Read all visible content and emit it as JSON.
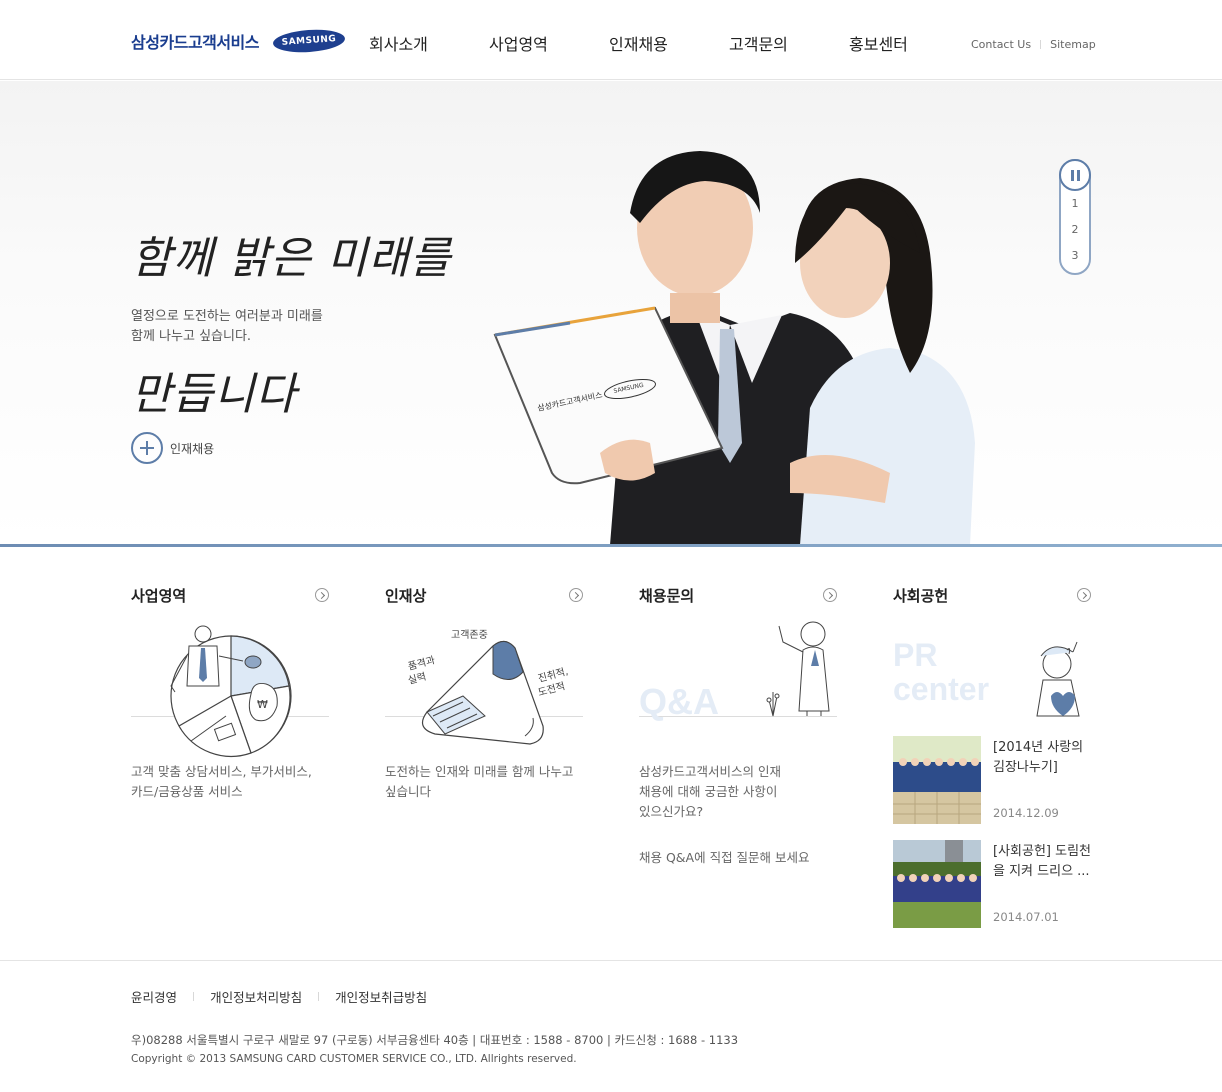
{
  "header": {
    "logo_text": "삼성카드고객서비스",
    "logo_badge": "SAMSUNG",
    "nav": [
      "회사소개",
      "사업영역",
      "인재채용",
      "고객문의",
      "홍보센터"
    ],
    "util": {
      "contact": "Contact Us",
      "sitemap": "Sitemap"
    }
  },
  "hero": {
    "title_line1": "함께 밝은 미래를",
    "title_line2": "만듭니다",
    "desc_line1": "열정으로 도전하는 여러분과 미래를",
    "desc_line2": "함께 나누고 싶습니다.",
    "link_label": "인재채용",
    "laptop_text": "삼성카드고객서비스",
    "laptop_badge": "SAMSUNG",
    "pager": {
      "pages": [
        "1",
        "2",
        "3"
      ]
    }
  },
  "sections": {
    "business": {
      "title": "사업영역",
      "text": "고객 맞춤 상담서비스, 부가서비스,\n카드/금융상품 서비스"
    },
    "talent": {
      "title": "인재상",
      "ill_label1": "고객존중",
      "ill_label2a": "품격과",
      "ill_label2b": "실력",
      "ill_label3a": "진취적,",
      "ill_label3b": "도전적",
      "text": "도전하는 인재와 미래를 함께 나누고\n싶습니다"
    },
    "recruit": {
      "title": "채용문의",
      "ill_label": "Q&A",
      "text": "삼성카드고객서비스의 인재\n채용에 대해 궁금한 사항이\n있으신가요?",
      "text2": "채용 Q&A에 직접 질문해 보세요"
    },
    "social": {
      "title": "사회공헌",
      "ill_label1": "PR",
      "ill_label2": "center",
      "items": [
        {
          "title": "[2014년 사랑의 김장나누기]",
          "date": "2014.12.09"
        },
        {
          "title": "[사회공헌] 도림천을 지켜 드리으 ...",
          "date": "2014.07.01"
        }
      ]
    }
  },
  "footer": {
    "links": [
      "윤리경영",
      "개인정보처리방침",
      "개인정보취급방침"
    ],
    "address": "우)08288 서울특별시 구로구 새말로 97 (구로동) 서부금융센타 40층   |   대표번호 : 1588 - 8700   |   카드신청 : 1688 - 1133",
    "copyright": "Copyright © 2013 SAMSUNG CARD CUSTOMER SERVICE CO., LTD. Allrights reserved."
  },
  "colors": {
    "brand": "#1a3d8f",
    "accent": "#5d7da8",
    "light_blue": "#dde9f6"
  }
}
